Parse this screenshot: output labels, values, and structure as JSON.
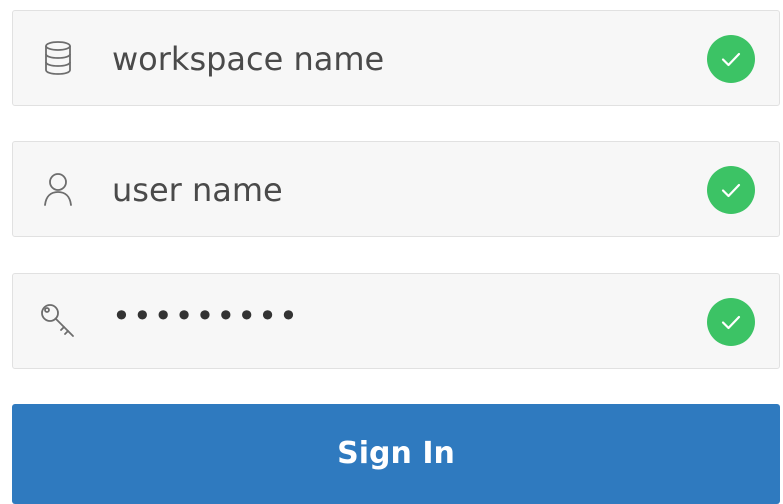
{
  "form": {
    "workspace": {
      "value": "workspace name",
      "icon": "database-icon",
      "valid": true
    },
    "username": {
      "value": "user name",
      "icon": "user-icon",
      "valid": true
    },
    "password": {
      "value": "•••••••••",
      "icon": "key-icon",
      "valid": true
    },
    "submit_label": "Sign In"
  },
  "colors": {
    "field_bg": "#f7f7f7",
    "field_border": "#e1e1e1",
    "valid_check": "#3cc365",
    "primary_button": "#2f7abf",
    "text": "#4a4a4a"
  }
}
